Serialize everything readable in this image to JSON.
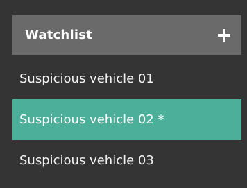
{
  "watchlist": {
    "title": "Watchlist",
    "add_icon": "plus-icon",
    "items": [
      {
        "label": "Suspicious vehicle 01",
        "selected": false
      },
      {
        "label": "Suspicious vehicle 02 *",
        "selected": true
      },
      {
        "label": "Suspicious vehicle 03",
        "selected": false
      }
    ]
  },
  "colors": {
    "background": "#343434",
    "header": "#6a6a6a",
    "selected": "#4caf9a",
    "text": "#ffffff"
  }
}
